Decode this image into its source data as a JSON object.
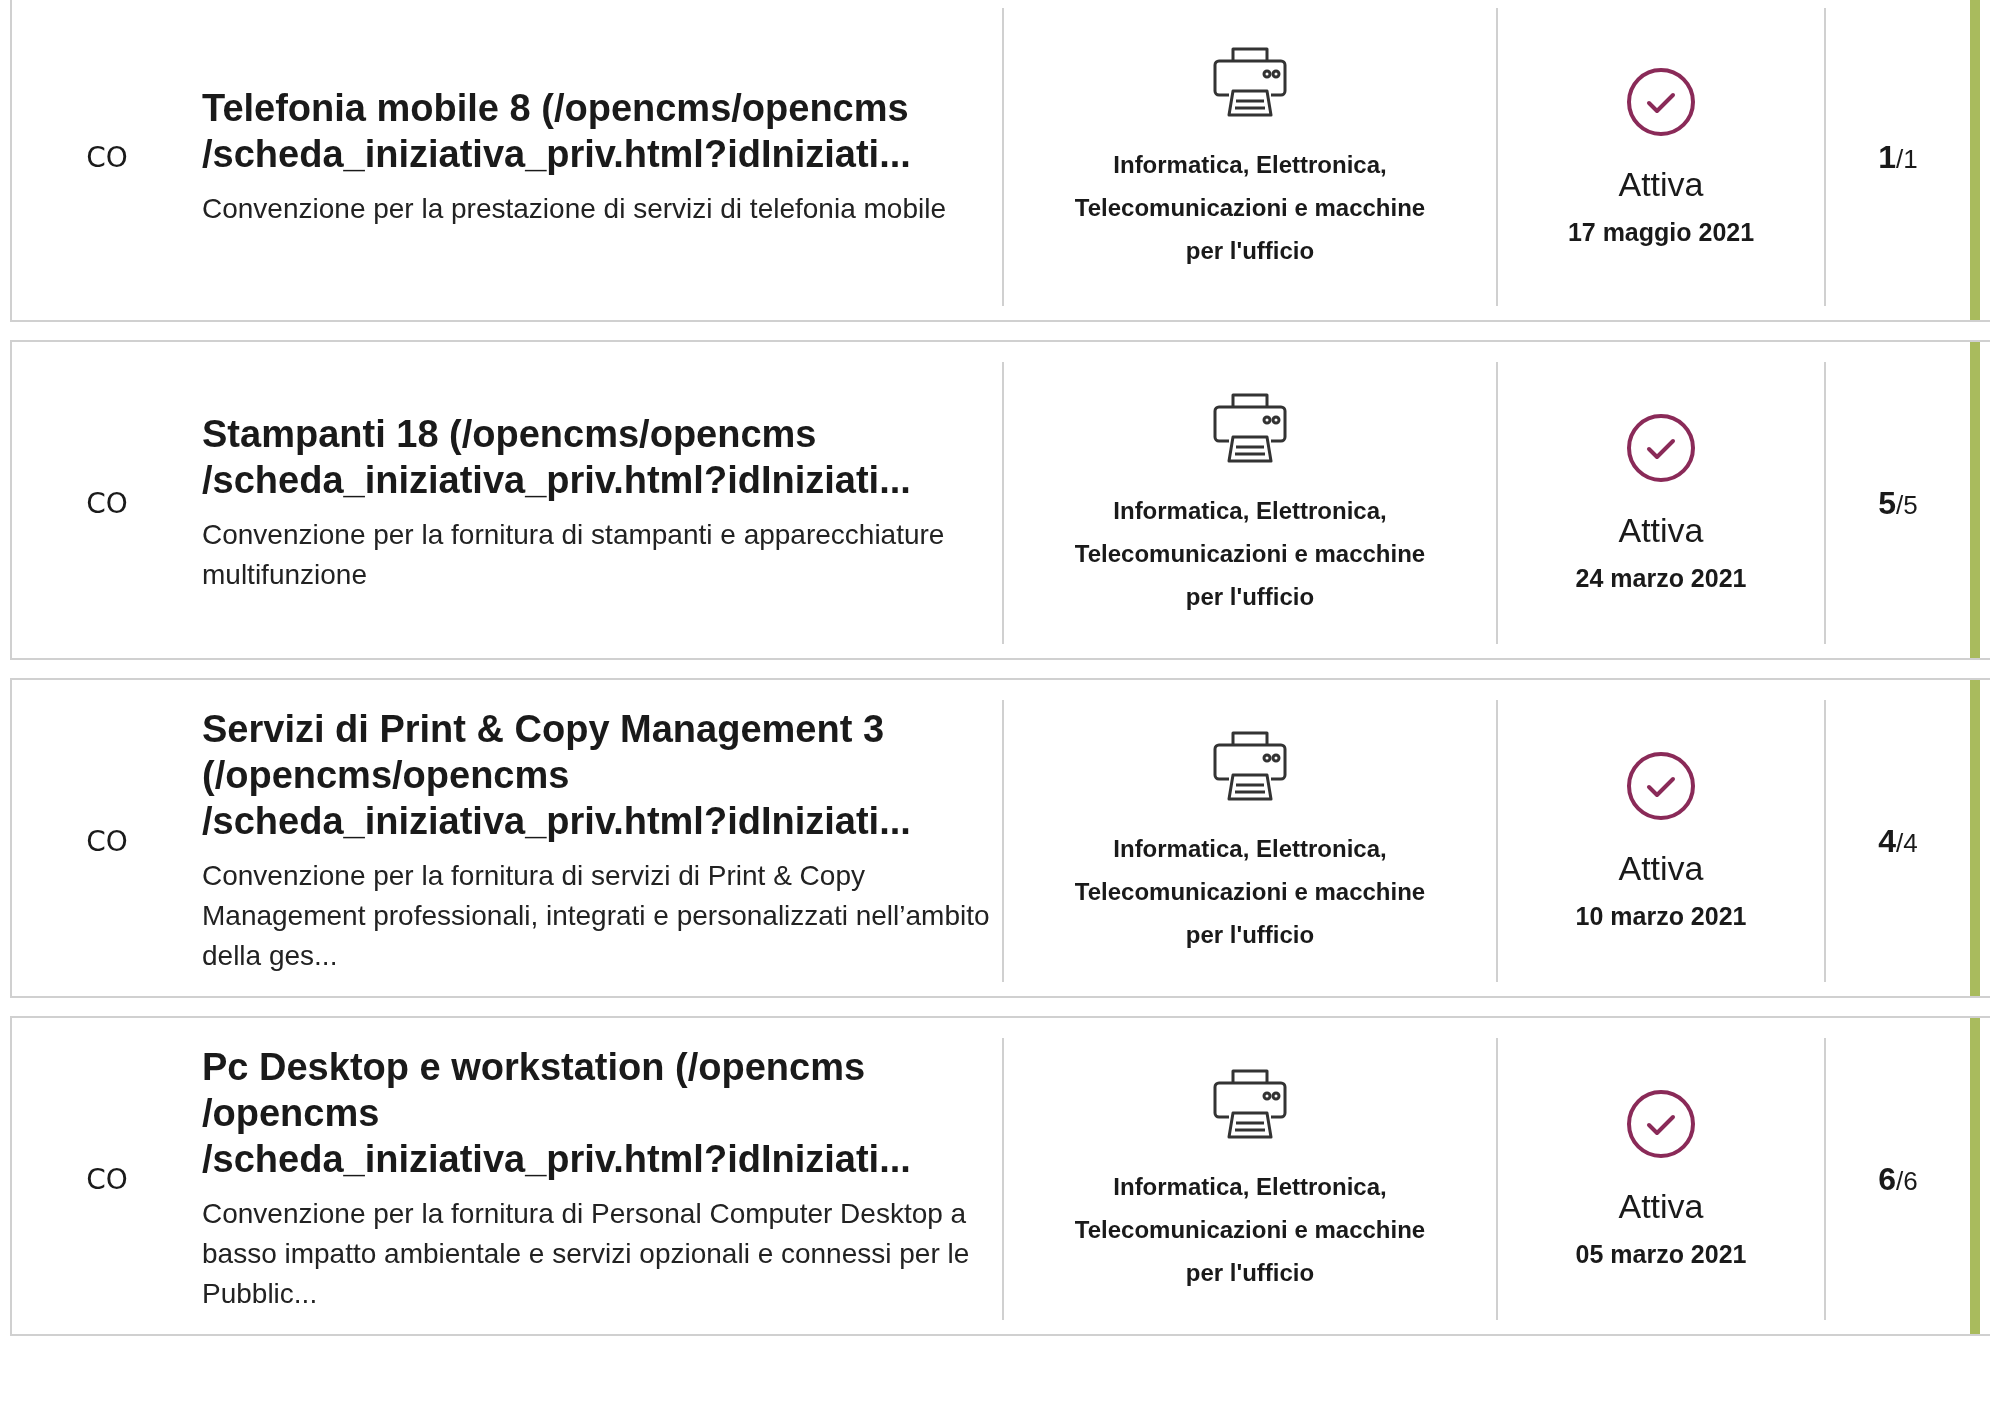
{
  "cards": [
    {
      "code": "CO",
      "title": "Telefonia mobile 8 (/opencms/opencms\n/scheda_iniziativa_priv.html?idIniziati...",
      "description": "Convenzione per la prestazione di servizi di telefonia mobile",
      "category": "Informatica, Elettronica, Telecomunicazioni e macchine per l'ufficio",
      "status": {
        "kind": "active",
        "label": "Attiva",
        "date": "17 maggio 2021"
      },
      "count": "**1**/1"
    },
    {
      "code": "CO",
      "title": "Stampanti 18 (/opencms/opencms\n/scheda_iniziativa_priv.html?idIniziati...",
      "description": "Convenzione per la fornitura di stampanti e apparecchiature multifunzione",
      "category": "Informatica, Elettronica, Telecomunicazioni e macchine per l'ufficio",
      "status": {
        "kind": "active",
        "label": "Attiva",
        "date": "24 marzo 2021"
      },
      "count": "**5**/5"
    },
    {
      "code": "CO",
      "title": "Servizi di Print & Copy Management 3\n(/opencms/opencms\n/scheda_iniziativa_priv.html?idIniziati...",
      "description": "Convenzione per la fornitura di servizi di Print & Copy Management professionali, integrati e personalizzati nell’ambito della ges...",
      "category": "Informatica, Elettronica, Telecomunicazioni e macchine per l'ufficio",
      "status": {
        "kind": "active",
        "label": "Attiva",
        "date": "10 marzo 2021"
      },
      "count": "**4**/4"
    },
    {
      "code": "CO",
      "title": "Pc Desktop e workstation (/opencms\n/opencms\n/scheda_iniziativa_priv.html?idIniziati...",
      "description": "Convenzione per la fornitura di Personal Computer Desktop a basso impatto ambientale e servizi opzionali e connessi per le Pubblic...",
      "category": "Informatica, Elettronica, Telecomunicazioni e macchine per l'ufficio",
      "status": {
        "kind": "active",
        "label": "Attiva",
        "date": "05 marzo 2021"
      },
      "count": "**6**/6"
    }
  ]
}
